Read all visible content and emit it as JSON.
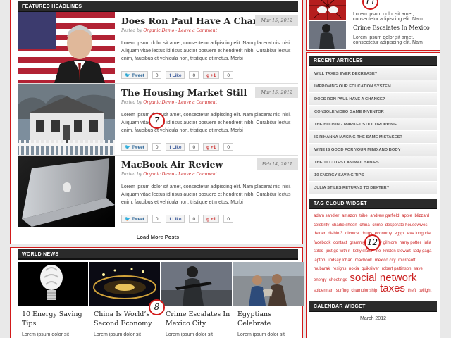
{
  "featured": {
    "heading": "FEATURED HEADLINES",
    "posts": [
      {
        "title": "Does Ron Paul Have A Chance?",
        "date": "Mar 15, 2012",
        "posted_by": "Posted by",
        "author": "Organic Demo",
        "sep": " - ",
        "comment": "Leave a Comment",
        "excerpt": "Lorem ipsum dolor sit amet, consectetur adipiscing elit. Nam placerat nisi nisi. Aliquam vitae lectus id risus auctor posuere et hendrerit nibh. Curabitur lectus enim, faucibus et vehicula non, tristique et metus. Morbi",
        "tweet": "Tweet",
        "tweet_count": "0",
        "like": "Like",
        "like_count": "0",
        "plus": "+1",
        "plus_count": "0"
      },
      {
        "title": "The Housing Market Still",
        "date": "Mar 15, 2012",
        "posted_by": "Posted by",
        "author": "Organic Demo",
        "sep": " - ",
        "comment": "Leave a Comment",
        "excerpt": "Lorem ipsum dolor sit amet, consectetur adipiscing elit. Nam placerat nisi nisi. Aliquam vitae lectus id risus auctor posuere et hendrerit nibh. Curabitur lectus enim, faucibus et vehicula non, tristique et metus. Morbi",
        "tweet": "Tweet",
        "tweet_count": "0",
        "like": "Like",
        "like_count": "0",
        "plus": "+1",
        "plus_count": "0"
      },
      {
        "title": "MacBook Air Review",
        "date": "Feb 14, 2011",
        "posted_by": "Posted by",
        "author": "Organic Demo",
        "sep": " - ",
        "comment": "Leave a Comment",
        "excerpt": "Lorem ipsum dolor sit amet, consectetur adipiscing elit. Nam placerat nisi nisi. Aliquam vitae lectus id risus auctor posuere et hendrerit nibh. Curabitur lectus enim, faucibus et vehicula non, tristique et metus. Morbi",
        "tweet": "Tweet",
        "tweet_count": "0",
        "like": "Like",
        "like_count": "0",
        "plus": "+1",
        "plus_count": "0"
      }
    ],
    "load_more": "Load More Posts"
  },
  "world_news": {
    "heading": "WORLD NEWS",
    "items": [
      {
        "title": "10 Energy Saving Tips",
        "excerpt": "Lorem ipsum dolor sit"
      },
      {
        "title": "China Is World’s Second Economy",
        "excerpt": "Lorem ipsum dolor sit"
      },
      {
        "title": "Crime Escalates In Mexico City",
        "excerpt": "Lorem ipsum dolor sit"
      },
      {
        "title": "Egyptians Celebrate",
        "excerpt": "Lorem ipsum dolor sit"
      }
    ]
  },
  "sidebar_top": {
    "items": [
      {
        "excerpt": "Lorem ipsum dolor sit amet, consectetur adipiscing elit. Nam"
      },
      {
        "title": "Crime Escalates In Mexico",
        "excerpt": "Lorem ipsum dolor sit amet, consectetur adipiscing elit. Nam"
      }
    ]
  },
  "recent_articles": {
    "heading": "RECENT ARTICLES",
    "items": [
      "WILL TAXES EVER DECREASE?",
      "IMPROVING OUR EDUCATION SYSTEM",
      "DOES RON PAUL HAVE A CHANCE?",
      "CONSOLE VIDEO GAME INVENTOR",
      "THE HOUSING MARKET STILL DROPPING",
      "IS RIHANNA MAKING THE SAME MISTAKES?",
      "WINE IS GOOD FOR YOUR MIND AND BODY",
      "THE 10 CUTEST ANIMAL BABIES",
      "10 ENERGY SAVING TIPS",
      "JULIA STILES RETURNS TO DEXTER?"
    ]
  },
  "tag_cloud": {
    "heading": "TAG CLOUD WIDGET",
    "tags": [
      {
        "text": "adam sandler",
        "size": "s"
      },
      {
        "text": "amazon",
        "size": "s"
      },
      {
        "text": "tribe",
        "size": "s"
      },
      {
        "text": "andrew garfield",
        "size": "s"
      },
      {
        "text": "apple",
        "size": "s"
      },
      {
        "text": "blizzard",
        "size": "s"
      },
      {
        "text": "celebrity",
        "size": "s"
      },
      {
        "text": "charlie sheen",
        "size": "s"
      },
      {
        "text": "china",
        "size": "s"
      },
      {
        "text": "crime",
        "size": "s"
      },
      {
        "text": "desperate housewives",
        "size": "s"
      },
      {
        "text": "dexter",
        "size": "s"
      },
      {
        "text": "diablo 3",
        "size": "s"
      },
      {
        "text": "divorce",
        "size": "s"
      },
      {
        "text": "drugs",
        "size": "s"
      },
      {
        "text": "economy",
        "size": "s"
      },
      {
        "text": "egypt",
        "size": "s"
      },
      {
        "text": "eva longoria",
        "size": "s"
      },
      {
        "text": "facebook",
        "size": "s"
      },
      {
        "text": "contact",
        "size": "s"
      },
      {
        "text": "grammy's",
        "size": "s"
      },
      {
        "text": "happy gilmore",
        "size": "s"
      },
      {
        "text": "harry potter",
        "size": "s"
      },
      {
        "text": "julia stiles",
        "size": "s"
      },
      {
        "text": "just go with it",
        "size": "s"
      },
      {
        "text": "kelly slater",
        "size": "s"
      },
      {
        "text": "life",
        "size": "s"
      },
      {
        "text": "kristen stewart",
        "size": "s"
      },
      {
        "text": "lady gaga",
        "size": "s"
      },
      {
        "text": "laptop",
        "size": "s"
      },
      {
        "text": "lindsay lohan",
        "size": "s"
      },
      {
        "text": "macbook",
        "size": "s"
      },
      {
        "text": "mexico city",
        "size": "s"
      },
      {
        "text": "microsoft",
        "size": "s"
      },
      {
        "text": "mubarak",
        "size": "s"
      },
      {
        "text": "resigns",
        "size": "s"
      },
      {
        "text": "nokia",
        "size": "s"
      },
      {
        "text": "quiksilver",
        "size": "s"
      },
      {
        "text": "robert pattinson",
        "size": "s"
      },
      {
        "text": "save energy",
        "size": "s"
      },
      {
        "text": "shootings",
        "size": "s"
      },
      {
        "text": "social network",
        "size": "l"
      },
      {
        "text": "spiderman",
        "size": "s"
      },
      {
        "text": "surfing",
        "size": "s"
      },
      {
        "text": "championship",
        "size": "s"
      },
      {
        "text": "taxes",
        "size": "l"
      },
      {
        "text": "theft",
        "size": "s"
      },
      {
        "text": "twilight",
        "size": "s"
      }
    ]
  },
  "calendar": {
    "heading": "CALENDAR WIDGET",
    "month": "March 2012"
  },
  "badges": {
    "b7": "7",
    "b8": "8",
    "b11": "11",
    "b12": "12"
  }
}
